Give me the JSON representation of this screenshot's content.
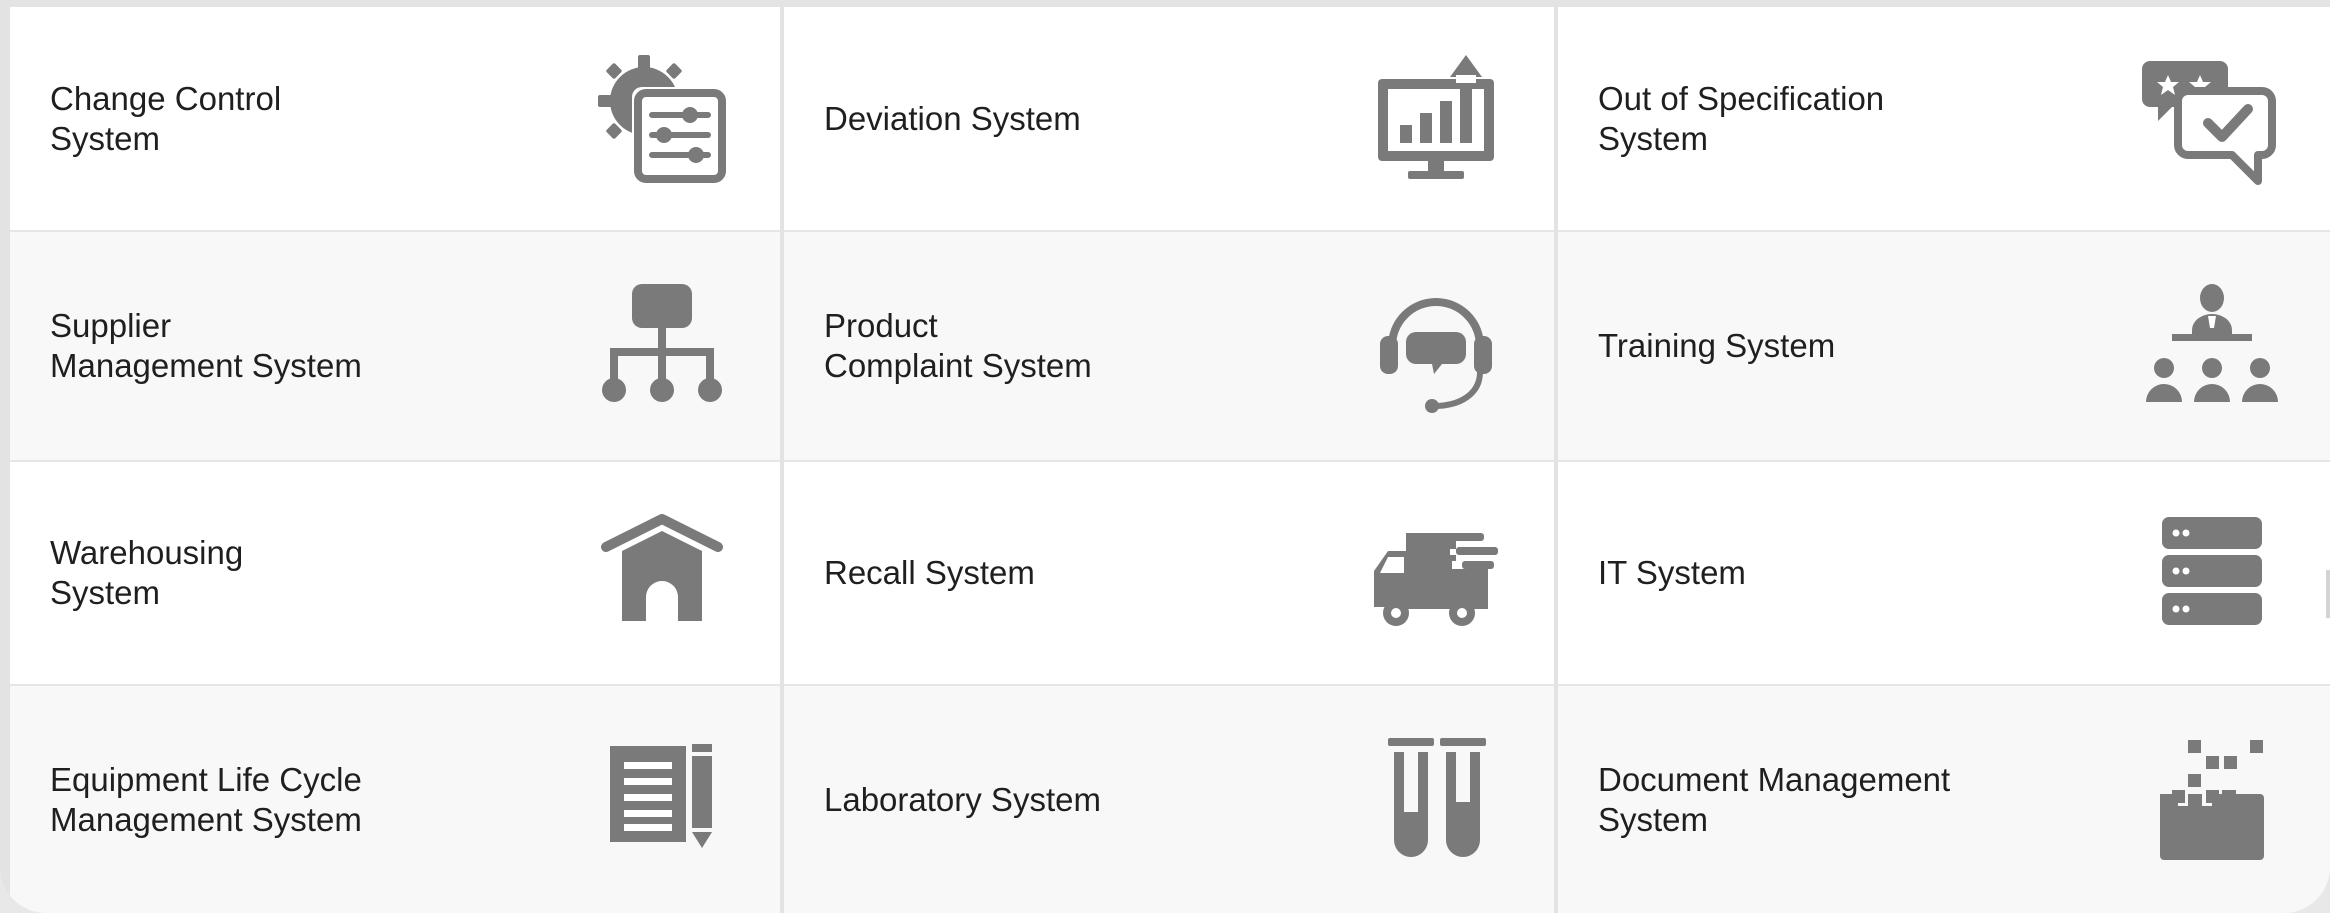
{
  "grid": {
    "items": [
      {
        "label": "Change Control\nSystem",
        "icon": "gear-settings-icon"
      },
      {
        "label": "Deviation System",
        "icon": "monitor-chart-icon"
      },
      {
        "label": "Out of Specification\nSystem",
        "icon": "review-chat-icon"
      },
      {
        "label": "Supplier\nManagement System",
        "icon": "org-chart-icon"
      },
      {
        "label": "Product\nComplaint System",
        "icon": "headset-icon"
      },
      {
        "label": "Training System",
        "icon": "presenter-audience-icon"
      },
      {
        "label": "Warehousing\nSystem",
        "icon": "warehouse-icon"
      },
      {
        "label": "Recall System",
        "icon": "delivery-truck-icon"
      },
      {
        "label": "IT System",
        "icon": "server-stack-icon"
      },
      {
        "label": "Equipment Life Cycle\nManagement System",
        "icon": "document-pencil-icon"
      },
      {
        "label": "Laboratory System",
        "icon": "test-tubes-icon"
      },
      {
        "label": "Document Management\nSystem",
        "icon": "folder-blocks-icon"
      }
    ]
  },
  "colors": {
    "icon": "#7a7a7a",
    "text": "#1f1f1f",
    "cell_light": "#ffffff",
    "cell_shaded": "#f8f8f8",
    "divider": "#e3e3e3"
  }
}
